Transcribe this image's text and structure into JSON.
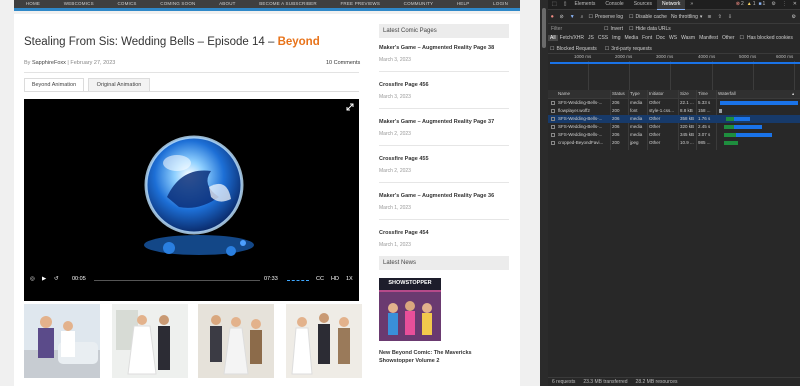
{
  "nav": {
    "items": [
      "HOME",
      "WEBCOMICS",
      "COMICS",
      "COMING SOON",
      "ABOUT",
      "BECOME A SUBSCRIBER",
      "FREE PREVIEWS",
      "COMMUNITY",
      "HELP",
      "LOGIN"
    ]
  },
  "post": {
    "title_main": "Stealing From Sis: Wedding Bells – Episode 14 – ",
    "title_highlight": "Beyond",
    "author": "SapphireFoxx",
    "date": "February 27, 2023",
    "comments": "10 Comments",
    "tabs": [
      "Beyond Animation",
      "Original Animation"
    ]
  },
  "video": {
    "current_time": "00:05",
    "duration": "07:33",
    "cc": "CC",
    "hd": "HD",
    "speed": "1X",
    "progress": 0.01
  },
  "sidebar": {
    "latest_comics_heading": "Latest Comic Pages",
    "comics": [
      {
        "title": "Maker's Game – Augmented Reality Page 38",
        "date": "March 3, 2023"
      },
      {
        "title": "Crossfire Page 456",
        "date": "March 3, 2023"
      },
      {
        "title": "Maker's Game – Augmented Reality Page 37",
        "date": "March 2, 2023"
      },
      {
        "title": "Crossfire Page 455",
        "date": "March 2, 2023"
      },
      {
        "title": "Maker's Game – Augmented Reality Page 36",
        "date": "March 1, 2023"
      },
      {
        "title": "Crossfire Page 454",
        "date": "March 1, 2023"
      }
    ],
    "latest_news_heading": "Latest News",
    "news_image_label": "SHOWSTOPPER",
    "news_title_1": "New Beyond Comic: The Mavericks",
    "news_title_2": "Showstopper Volume 2"
  },
  "devtools": {
    "tabs": [
      "Elements",
      "Console",
      "Sources",
      "Network"
    ],
    "active_tab": "Network",
    "badges": {
      "errors": "2",
      "warnings": "1",
      "info": "1"
    },
    "toolbar": {
      "preserve_log": "Preserve log",
      "disable_cache": "Disable cache",
      "throttle": "No throttling"
    },
    "filter": {
      "placeholder": "Filter",
      "invert": "Invert",
      "hide_data_urls": "Hide data URLs"
    },
    "types": [
      "All",
      "Fetch/XHR",
      "JS",
      "CSS",
      "Img",
      "Media",
      "Font",
      "Doc",
      "WS",
      "Wasm",
      "Manifest",
      "Other"
    ],
    "has_blocked_cookies": "Has blocked cookies",
    "blocked_requests": "Blocked Requests",
    "third_party": "3rd-party requests",
    "timeline_ticks": [
      "1000 ms",
      "2000 ms",
      "3000 ms",
      "4000 ms",
      "5000 ms",
      "6000 ms"
    ],
    "columns": [
      "Name",
      "Status",
      "Type",
      "Initiator",
      "Size",
      "Time",
      "Waterfall"
    ],
    "requests": [
      {
        "name": "SFS-Wedding-Bells-...",
        "status": "206",
        "type": "media",
        "initiator": "Other",
        "size": "22.1 ...",
        "time": "5.33 s"
      },
      {
        "name": "flowplayer.woff2",
        "status": "200",
        "type": "font",
        "initiator": "style-1.css...",
        "size": "8.8 kB",
        "time": "158 ..."
      },
      {
        "name": "SFS-Wedding-Bells-...",
        "status": "206",
        "type": "media",
        "initiator": "Other",
        "size": "358 kB",
        "time": "1.76 s"
      },
      {
        "name": "SFS-Wedding-Bells-...",
        "status": "206",
        "type": "media",
        "initiator": "Other",
        "size": "320 kB",
        "time": "2.45 s"
      },
      {
        "name": "SFS-Wedding-Bells-...",
        "status": "206",
        "type": "media",
        "initiator": "Other",
        "size": "345 kB",
        "time": "3.07 s"
      },
      {
        "name": "cropped-BeyondFavi...",
        "status": "200",
        "type": "jpeg",
        "initiator": "Other",
        "size": "10.9 ...",
        "time": "985 ..."
      }
    ],
    "status_bar": {
      "requests": "6 requests",
      "transferred": "23.3 MB transferred",
      "resources": "28.2 MB resources"
    }
  },
  "colors": {
    "accent": "#e8731a",
    "nav_bg": "#3f3f3f",
    "nav_bar": "#2f88c8",
    "devtools_bg": "#282828",
    "selected_row": "#173a6a"
  }
}
